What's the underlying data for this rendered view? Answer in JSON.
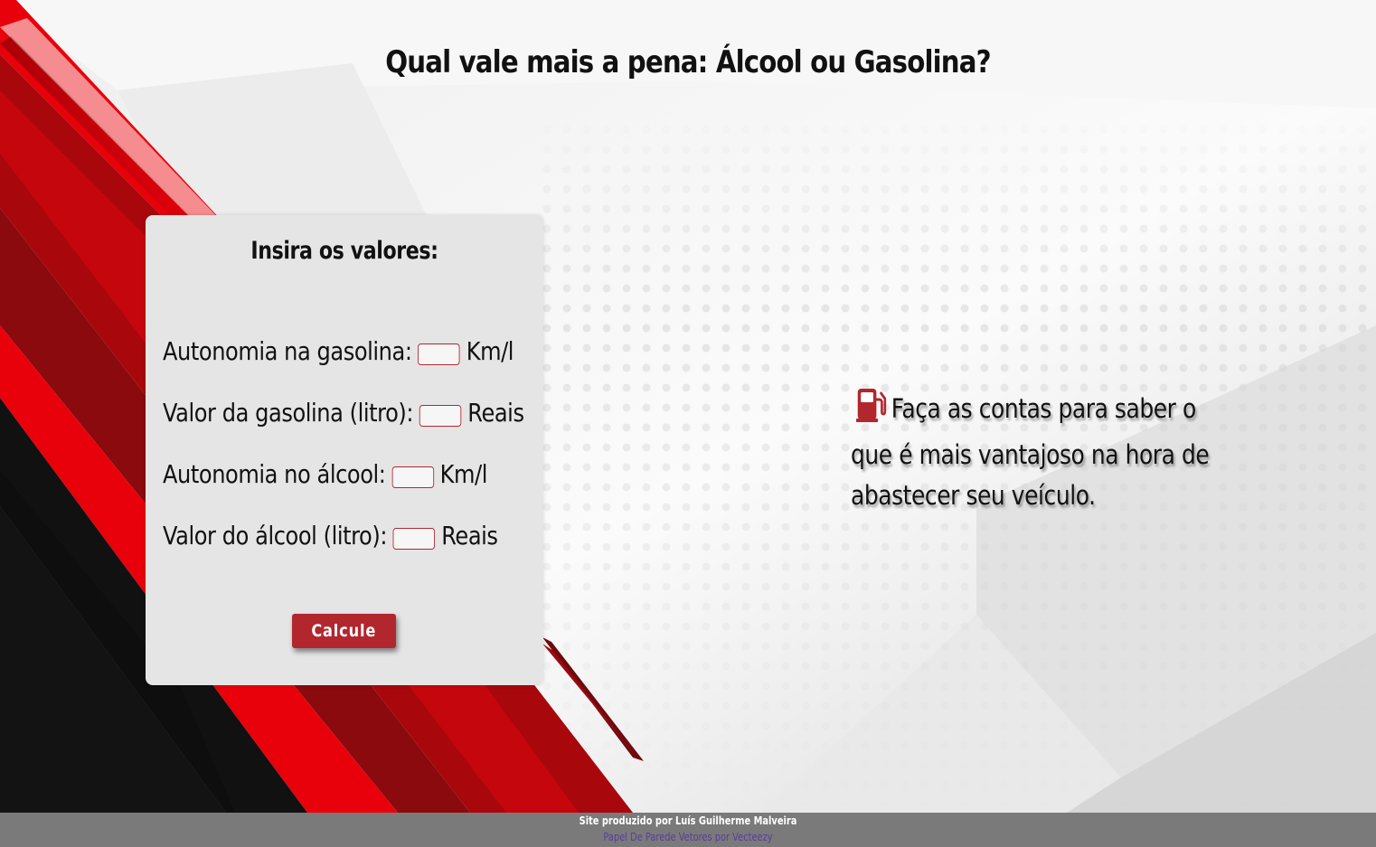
{
  "page": {
    "title": "Qual vale mais a pena: Álcool ou Gasolina?"
  },
  "form": {
    "heading": "Insira os valores:",
    "fields": [
      {
        "label": "Autonomia na gasolina:",
        "unit": "Km/l",
        "value": ""
      },
      {
        "label": "Valor da gasolina (litro):",
        "unit": "Reais",
        "value": ""
      },
      {
        "label": "Autonomia no álcool:",
        "unit": "Km/l",
        "value": ""
      },
      {
        "label": "Valor do álcool (litro):",
        "unit": "Reais",
        "value": ""
      }
    ],
    "submit_label": "Calcule"
  },
  "info": {
    "icon": "gas-pump-icon",
    "text": "Faça as contas para saber o que é mais vantajoso na hora de abastecer seu veículo."
  },
  "footer": {
    "credit": "Site produzido por Luís Guilherme Malveira",
    "link_text": "Papel De Parede Vetores por Vecteezy"
  },
  "colors": {
    "accent": "#b2262e",
    "bright_red": "#e8000b",
    "dark_red": "#8a0a0e",
    "footer_bg": "#7a7a7a",
    "link": "#5a3d9e"
  }
}
